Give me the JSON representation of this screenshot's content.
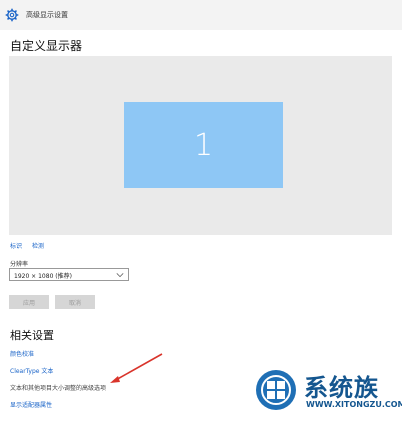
{
  "window": {
    "title": "高级显示设置"
  },
  "page": {
    "title": "自定义显示器"
  },
  "display_preview": {
    "monitor_number": "1",
    "background_color": "#eaeaea",
    "monitor_color": "#8ec7f5"
  },
  "links": {
    "identify": "标识",
    "detect": "检测"
  },
  "resolution": {
    "label": "分辨率",
    "value": "1920 × 1080 (推荐)"
  },
  "buttons": {
    "apply": "应用",
    "cancel": "取消"
  },
  "related": {
    "title": "相关设置",
    "items": [
      "颜色校准",
      "ClearType 文本",
      "文本和其他项目大小调整的高级选项",
      "显示适配器属性"
    ]
  },
  "watermark": {
    "brand": "系统族",
    "url": "WWW.XITONGZU.COM"
  },
  "colors": {
    "link": "#1a64c8",
    "arrow": "#d9342b",
    "watermark": "#14568f"
  }
}
